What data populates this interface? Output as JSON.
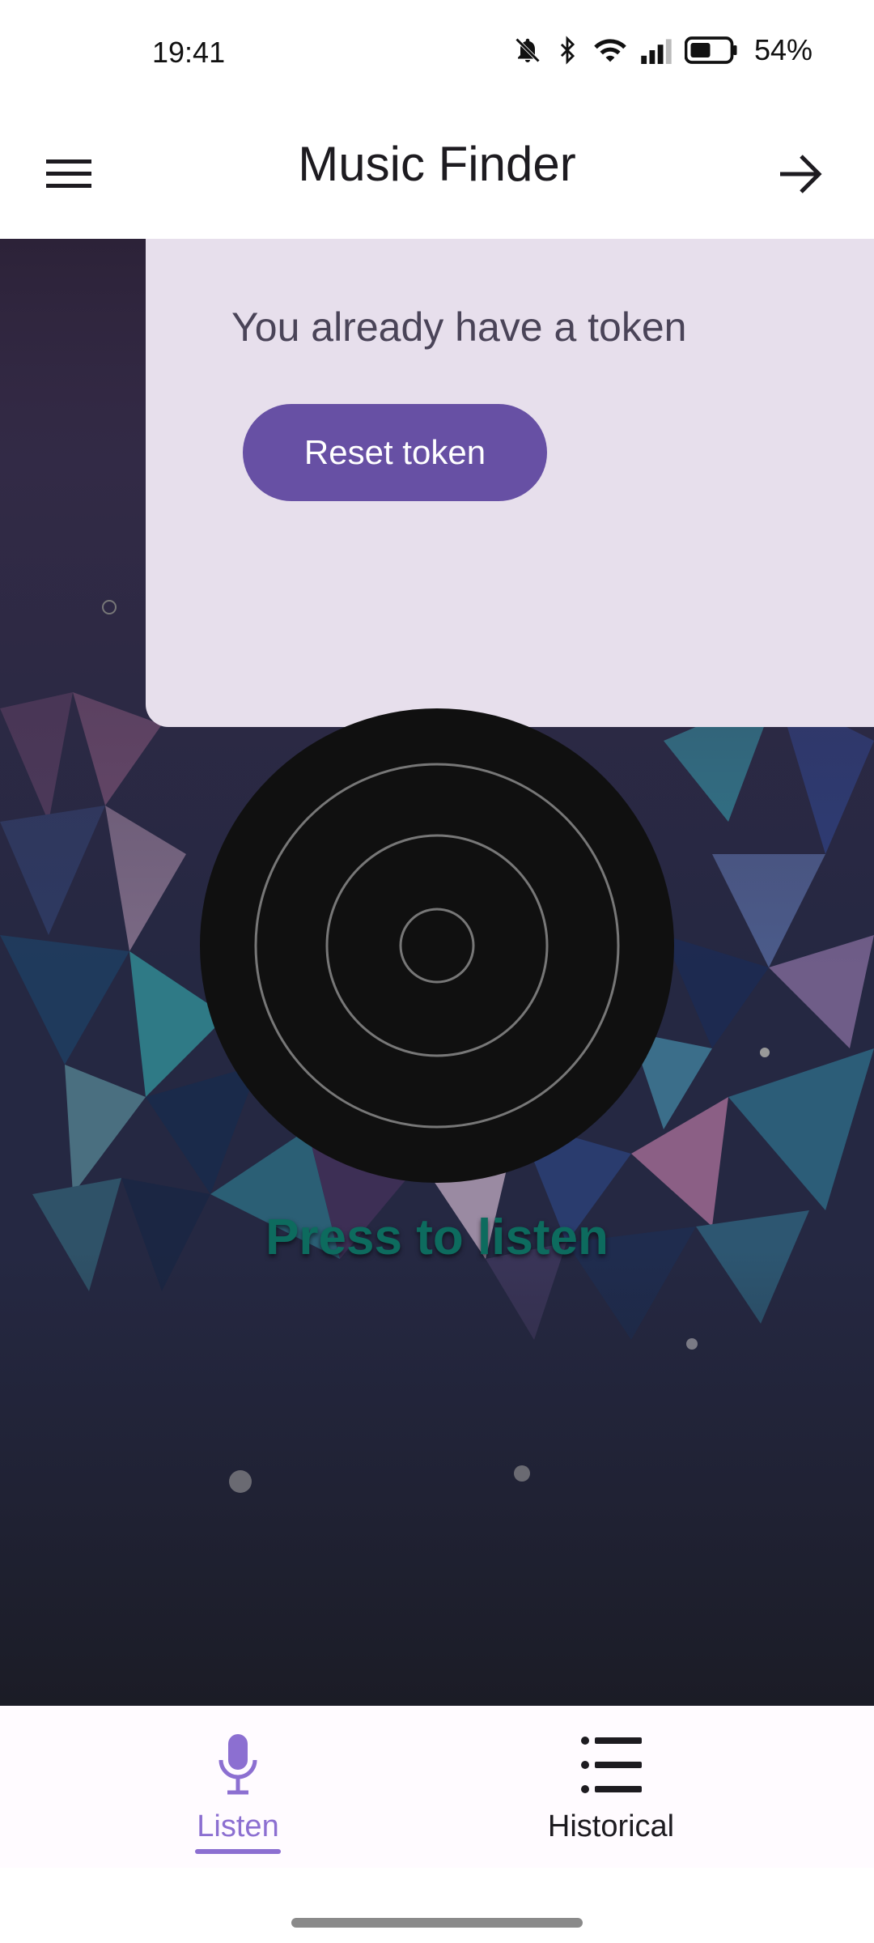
{
  "status_bar": {
    "time": "19:41",
    "battery_percent": "54%",
    "icons": [
      "bell-off-icon",
      "bluetooth-icon",
      "wifi-icon",
      "signal-icon",
      "battery-icon"
    ]
  },
  "app_bar": {
    "title": "Music Finder",
    "menu_icon": "menu-icon",
    "action_icon": "arrow-right-icon"
  },
  "token_card": {
    "message": "You already have a token",
    "reset_button_label": "Reset token"
  },
  "listen": {
    "label": "Press to listen"
  },
  "bottom_nav": {
    "items": [
      {
        "label": "Listen",
        "icon": "microphone-icon",
        "selected": true
      },
      {
        "label": "Historical",
        "icon": "list-icon",
        "selected": false
      }
    ]
  },
  "colors": {
    "accent": "#6750a4",
    "nav_selected": "#8c6fd1",
    "card_bg": "#e7dfec",
    "listen_label": "#0d6b5e"
  }
}
